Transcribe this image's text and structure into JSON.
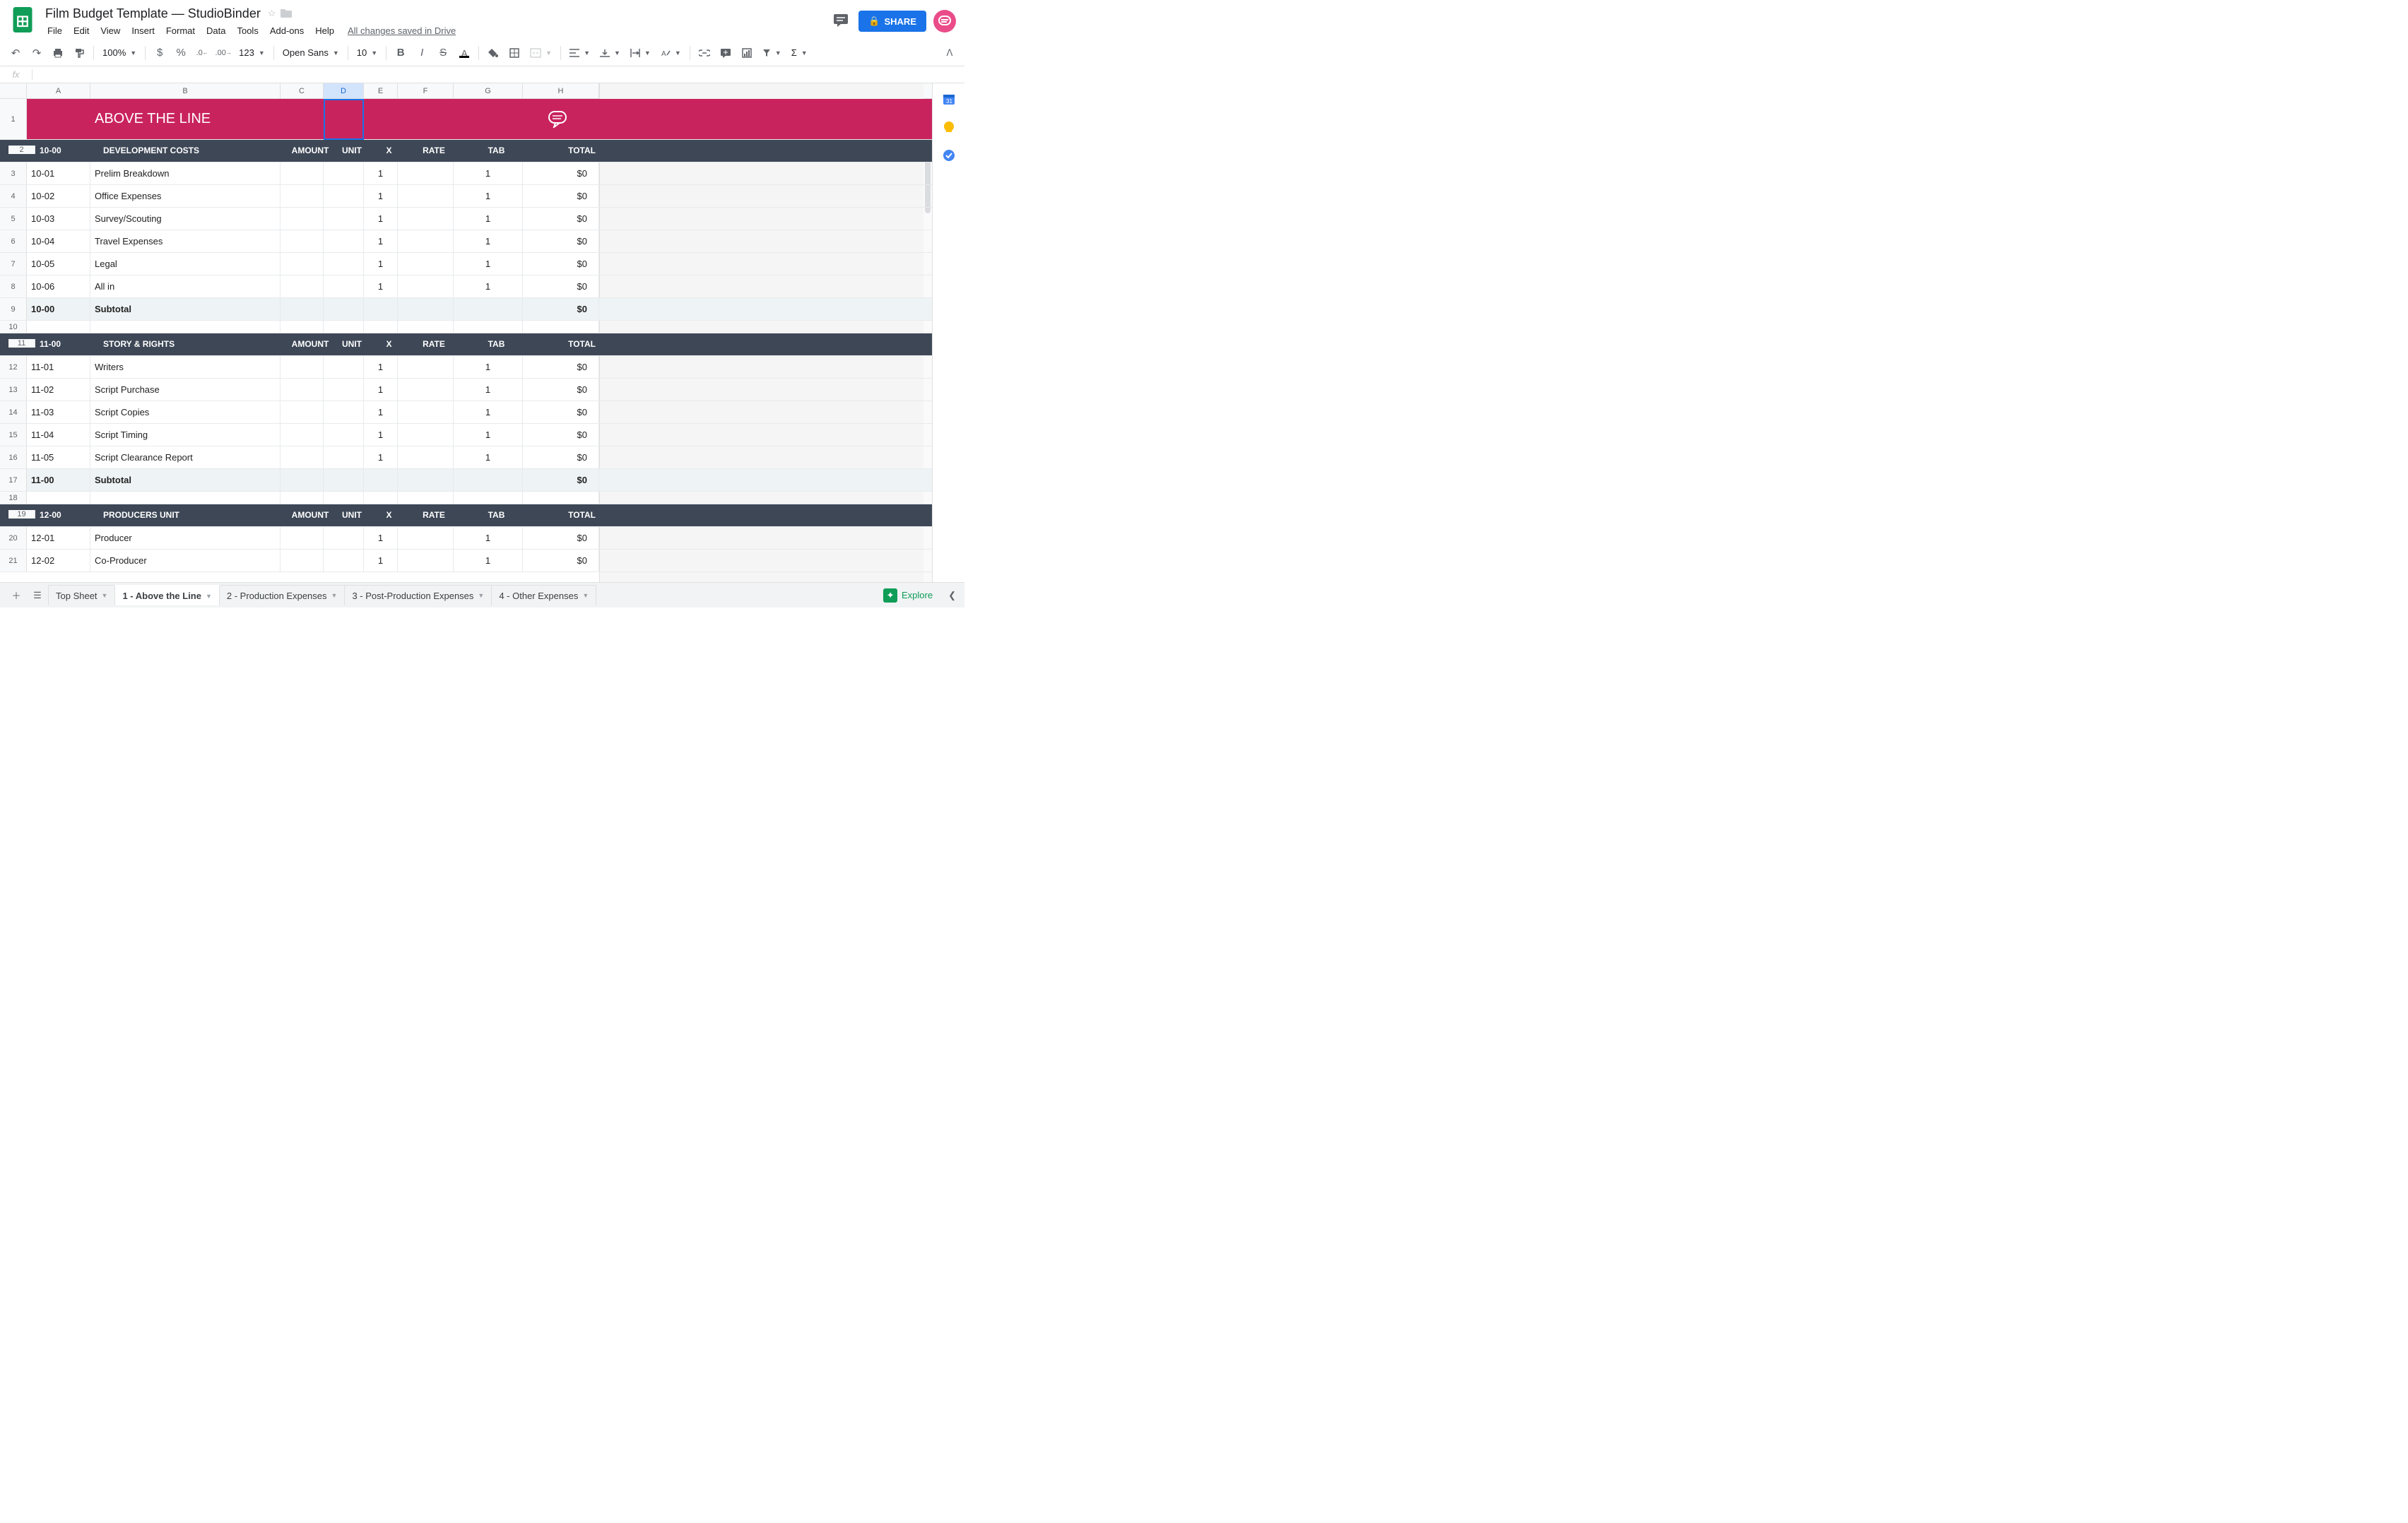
{
  "doc": {
    "title": "Film Budget Template — StudioBinder",
    "drive_status": "All changes saved in Drive",
    "share_label": "SHARE"
  },
  "menus": [
    "File",
    "Edit",
    "View",
    "Insert",
    "Format",
    "Data",
    "Tools",
    "Add-ons",
    "Help"
  ],
  "toolbar": {
    "zoom": "100%",
    "font_family": "Open Sans",
    "font_size": "10",
    "number_fmt": "123"
  },
  "columns": [
    "A",
    "B",
    "C",
    "D",
    "E",
    "F",
    "G",
    "H"
  ],
  "selected_column": "D",
  "banner": {
    "row": "1",
    "title": "ABOVE THE LINE"
  },
  "sections": [
    {
      "header_row": "2",
      "code": "10-00",
      "title": "DEVELOPMENT COSTS",
      "labels": {
        "amount": "AMOUNT",
        "unit": "UNIT",
        "x": "X",
        "rate": "RATE",
        "tab": "TAB",
        "total": "TOTAL"
      },
      "rows": [
        {
          "r": "3",
          "code": "10-01",
          "desc": "Prelim Breakdown",
          "x": "1",
          "tab": "1",
          "total": "$0"
        },
        {
          "r": "4",
          "code": "10-02",
          "desc": "Office Expenses",
          "x": "1",
          "tab": "1",
          "total": "$0"
        },
        {
          "r": "5",
          "code": "10-03",
          "desc": "Survey/Scouting",
          "x": "1",
          "tab": "1",
          "total": "$0"
        },
        {
          "r": "6",
          "code": "10-04",
          "desc": "Travel Expenses",
          "x": "1",
          "tab": "1",
          "total": "$0"
        },
        {
          "r": "7",
          "code": "10-05",
          "desc": "Legal",
          "x": "1",
          "tab": "1",
          "total": "$0"
        },
        {
          "r": "8",
          "code": "10-06",
          "desc": "All in",
          "x": "1",
          "tab": "1",
          "total": "$0"
        }
      ],
      "subtotal": {
        "r": "9",
        "code": "10-00",
        "label": "Subtotal",
        "total": "$0"
      },
      "blank_row": "10"
    },
    {
      "header_row": "11",
      "code": "11-00",
      "title": "STORY & RIGHTS",
      "labels": {
        "amount": "AMOUNT",
        "unit": "UNIT",
        "x": "X",
        "rate": "RATE",
        "tab": "TAB",
        "total": "TOTAL"
      },
      "rows": [
        {
          "r": "12",
          "code": "11-01",
          "desc": "Writers",
          "x": "1",
          "tab": "1",
          "total": "$0"
        },
        {
          "r": "13",
          "code": "11-02",
          "desc": "Script Purchase",
          "x": "1",
          "tab": "1",
          "total": "$0"
        },
        {
          "r": "14",
          "code": "11-03",
          "desc": "Script Copies",
          "x": "1",
          "tab": "1",
          "total": "$0"
        },
        {
          "r": "15",
          "code": "11-04",
          "desc": "Script Timing",
          "x": "1",
          "tab": "1",
          "total": "$0"
        },
        {
          "r": "16",
          "code": "11-05",
          "desc": "Script Clearance Report",
          "x": "1",
          "tab": "1",
          "total": "$0"
        }
      ],
      "subtotal": {
        "r": "17",
        "code": "11-00",
        "label": "Subtotal",
        "total": "$0"
      },
      "blank_row": "18"
    },
    {
      "header_row": "19",
      "code": "12-00",
      "title": "PRODUCERS UNIT",
      "labels": {
        "amount": "AMOUNT",
        "unit": "UNIT",
        "x": "X",
        "rate": "RATE",
        "tab": "TAB",
        "total": "TOTAL"
      },
      "rows": [
        {
          "r": "20",
          "code": "12-01",
          "desc": "Producer",
          "x": "1",
          "tab": "1",
          "total": "$0"
        },
        {
          "r": "21",
          "code": "12-02",
          "desc": "Co-Producer",
          "x": "1",
          "tab": "1",
          "total": "$0"
        }
      ]
    }
  ],
  "tabs": [
    {
      "label": "Top Sheet",
      "active": false
    },
    {
      "label": "1 - Above the Line",
      "active": true
    },
    {
      "label": "2 - Production Expenses",
      "active": false
    },
    {
      "label": "3 - Post-Production Expenses",
      "active": false
    },
    {
      "label": "4 - Other Expenses",
      "active": false
    }
  ],
  "explore_label": "Explore"
}
